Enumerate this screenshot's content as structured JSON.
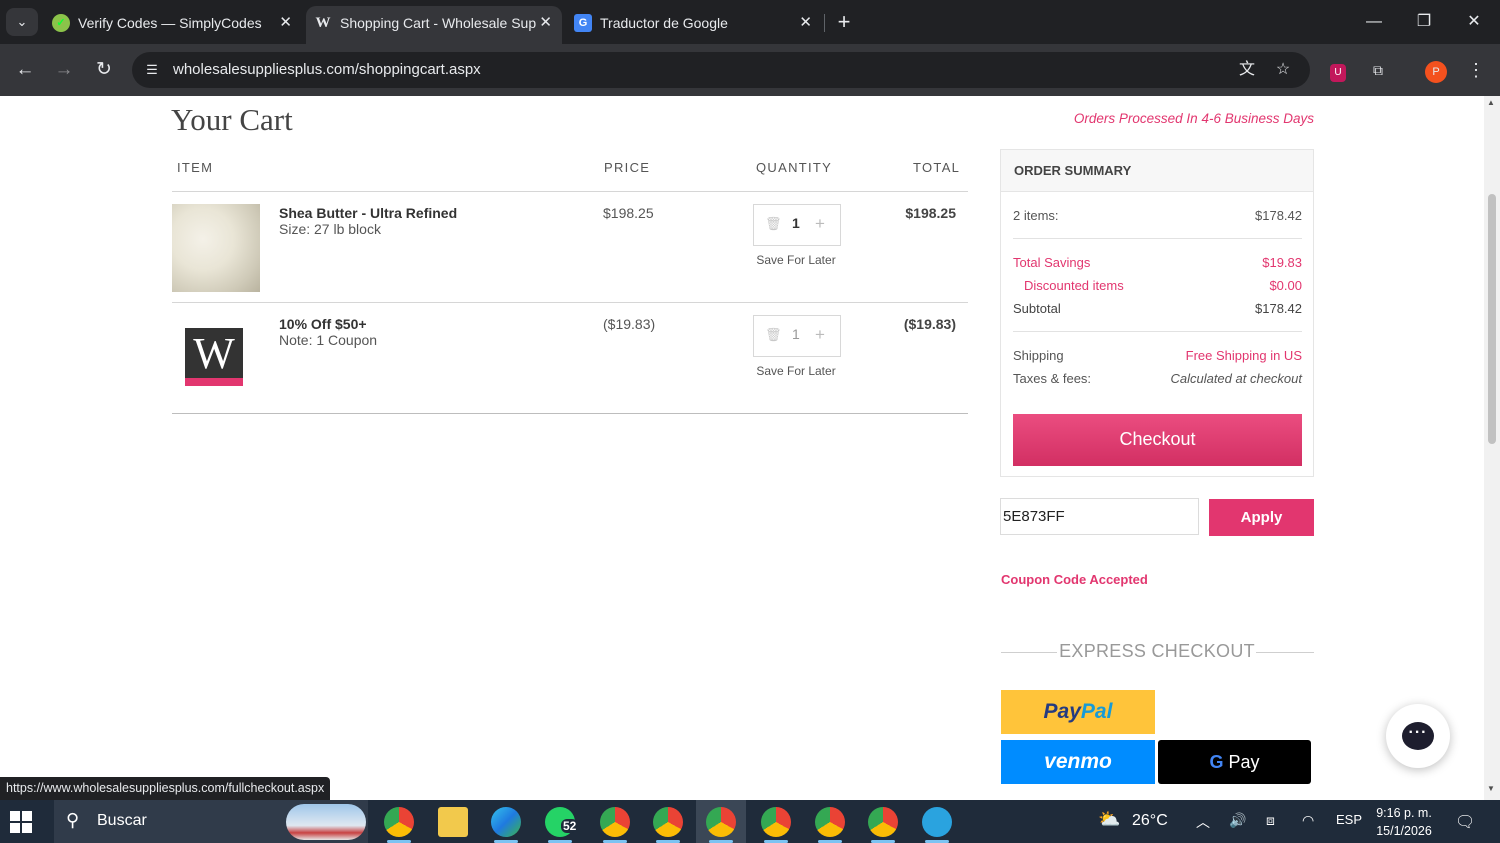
{
  "browser": {
    "tabs": [
      {
        "title": "Verify Codes — SimplyCodes",
        "active": false
      },
      {
        "title": "Shopping Cart - Wholesale Sup",
        "active": true
      },
      {
        "title": "Traductor de Google",
        "active": false
      }
    ],
    "url": "wholesalesuppliesplus.com/shoppingcart.aspx",
    "profile_initial": "P"
  },
  "page": {
    "title": "Your Cart",
    "orders_note": "Orders Processed In 4-6 Business Days",
    "columns": {
      "item": "ITEM",
      "price": "PRICE",
      "quantity": "QUANTITY",
      "total": "TOTAL"
    },
    "items": [
      {
        "name": "Shea Butter - Ultra Refined",
        "meta": "Size: 27 lb block",
        "price": "$198.25",
        "qty": "1",
        "total": "$198.25",
        "save_label": "Save For Later"
      },
      {
        "name": "10% Off $50+",
        "meta": "Note: 1 Coupon",
        "price": "($19.83)",
        "qty": "1",
        "total": "($19.83)",
        "save_label": "Save For Later"
      }
    ],
    "summary": {
      "title": "ORDER SUMMARY",
      "items_label": "2 items:",
      "items_value": "$178.42",
      "savings_label": "Total Savings",
      "savings_value": "$19.83",
      "discounted_label": "Discounted items",
      "discounted_value": "$0.00",
      "subtotal_label": "Subtotal",
      "subtotal_value": "$178.42",
      "shipping_label": "Shipping",
      "shipping_value": "Free Shipping in US",
      "taxes_label": "Taxes & fees:",
      "taxes_value": "Calculated at checkout",
      "checkout_label": "Checkout"
    },
    "coupon": {
      "value": "5E873FF",
      "apply_label": "Apply",
      "status": "Coupon Code Accepted"
    },
    "express": {
      "label": "EXPRESS CHECKOUT",
      "paypal_a": "Pay",
      "paypal_b": "Pal",
      "venmo": "venmo",
      "gpay_g": "G",
      "gpay_text": " Pay"
    },
    "logo_letter": "W"
  },
  "status_bar": {
    "url": "https://www.wholesalesuppliesplus.com/fullcheckout.aspx"
  },
  "taskbar": {
    "search_placeholder": "Buscar",
    "whatsapp_badge": "52",
    "temperature": "26°C",
    "language": "ESP",
    "time": "9:16 p. m.",
    "date": "15/1/2026"
  },
  "colors": {
    "accent": "#e2366f",
    "paypal_yellow": "#ffc43a",
    "venmo_blue": "#008cff"
  }
}
